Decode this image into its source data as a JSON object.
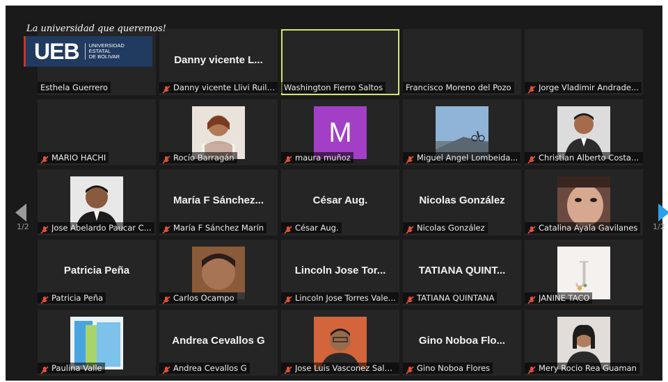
{
  "branding": {
    "slogan": "La universidad que queremos!",
    "logo_mark": "UEB",
    "logo_line1": "UNIVERSIDAD",
    "logo_line2": "ESTATAL",
    "logo_line3": "DE BOLIVAR"
  },
  "pagination": {
    "left_label": "1/2",
    "right_label": "1/2"
  },
  "colors": {
    "active_border": "#d4e86a",
    "muted_icon": "#e0523a",
    "nav_active": "#2aa0e8",
    "nav_inactive": "#9a9a9a"
  },
  "participants": [
    {
      "name": "Esthela Guerrero",
      "muted": false,
      "video": "blank"
    },
    {
      "name": "Danny vicente Llivi Ruilova",
      "muted": true,
      "display_name": "Danny vicente L..."
    },
    {
      "name": "Washington Fierro Saltos",
      "muted": false,
      "video": "blank",
      "active": true
    },
    {
      "name": "Francisco Moreno del Pozo",
      "muted": false,
      "video": "blank"
    },
    {
      "name": "Jorge Vladimir Andrade...",
      "muted": true,
      "video": "blank"
    },
    {
      "name": "MARIO HACHI",
      "muted": true,
      "video": "blank"
    },
    {
      "name": "Rocío Barragán",
      "muted": true,
      "video": "photo-woman"
    },
    {
      "name": "maura muñoz",
      "muted": true,
      "initial": "M"
    },
    {
      "name": "Miguel Angel Lombeida...",
      "muted": true,
      "video": "photo-bike"
    },
    {
      "name": "Christian Alberto Costal...",
      "muted": true,
      "video": "photo-man"
    },
    {
      "name": "Jose Abelardo Paucar C...",
      "muted": true,
      "video": "photo-man2"
    },
    {
      "name": "María F Sánchez Marín",
      "muted": true,
      "display_name": "María F Sánchez..."
    },
    {
      "name": "César Aug.",
      "muted": true,
      "display_name": "César Aug."
    },
    {
      "name": "Nicolas González",
      "muted": true,
      "display_name": "Nicolas González"
    },
    {
      "name": "Catalina Ayala Gavilanes",
      "muted": true,
      "video": "photo-girl"
    },
    {
      "name": "Patricia Peña",
      "muted": true,
      "display_name": "Patricia Peña"
    },
    {
      "name": "Carlos Ocampo",
      "muted": true,
      "video": "photo-man3"
    },
    {
      "name": "Lincoln Jose Torres Vale...",
      "muted": true,
      "display_name": "Lincoln Jose Tor..."
    },
    {
      "name": "TATIANA QUINTANA",
      "muted": true,
      "display_name": "TATIANA QUINT..."
    },
    {
      "name": "JANINE TACO",
      "muted": true,
      "video": "photo-letter"
    },
    {
      "name": "Paulina Valle",
      "muted": true,
      "video": "photo-folders"
    },
    {
      "name": "Andrea Cevallos G",
      "muted": true,
      "display_name": "Andrea Cevallos G"
    },
    {
      "name": "Jose Luis Vasconez Sala...",
      "muted": true,
      "video": "photo-man4"
    },
    {
      "name": "Gino Noboa Flores",
      "muted": true,
      "display_name": "Gino Noboa Flo..."
    },
    {
      "name": "Mery Rocio Rea Guaman",
      "muted": true,
      "video": "photo-woman2"
    }
  ]
}
